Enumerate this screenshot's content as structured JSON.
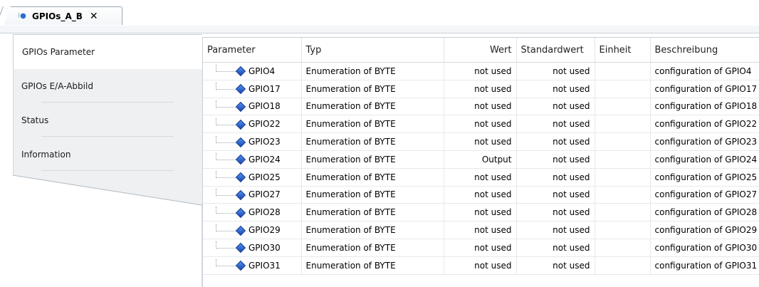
{
  "tab": {
    "title": "GPIOs_A_B",
    "close_symbol": "✕",
    "icon": "device-io-icon"
  },
  "nav": {
    "items": [
      {
        "label": "GPIOs Parameter",
        "active": true
      },
      {
        "label": "GPIOs E/A-Abbild",
        "active": false
      },
      {
        "label": "Status",
        "active": false
      },
      {
        "label": "Information",
        "active": false
      }
    ]
  },
  "table": {
    "columns": [
      "Parameter",
      "Typ",
      "Wert",
      "Standardwert",
      "Einheit",
      "Beschreibung"
    ],
    "rows": [
      {
        "param": "GPIO4",
        "typ": "Enumeration of BYTE",
        "wert": "not used",
        "standard": "not used",
        "einheit": "",
        "beschreibung": "configuration of GPIO4"
      },
      {
        "param": "GPIO17",
        "typ": "Enumeration of BYTE",
        "wert": "not used",
        "standard": "not used",
        "einheit": "",
        "beschreibung": "configuration of GPIO17"
      },
      {
        "param": "GPIO18",
        "typ": "Enumeration of BYTE",
        "wert": "not used",
        "standard": "not used",
        "einheit": "",
        "beschreibung": "configuration of GPIO18"
      },
      {
        "param": "GPIO22",
        "typ": "Enumeration of BYTE",
        "wert": "not used",
        "standard": "not used",
        "einheit": "",
        "beschreibung": "configuration of GPIO22"
      },
      {
        "param": "GPIO23",
        "typ": "Enumeration of BYTE",
        "wert": "not used",
        "standard": "not used",
        "einheit": "",
        "beschreibung": "configuration of GPIO23"
      },
      {
        "param": "GPIO24",
        "typ": "Enumeration of BYTE",
        "wert": "Output",
        "standard": "not used",
        "einheit": "",
        "beschreibung": "configuration of GPIO24"
      },
      {
        "param": "GPIO25",
        "typ": "Enumeration of BYTE",
        "wert": "not used",
        "standard": "not used",
        "einheit": "",
        "beschreibung": "configuration of GPIO25"
      },
      {
        "param": "GPIO27",
        "typ": "Enumeration of BYTE",
        "wert": "not used",
        "standard": "not used",
        "einheit": "",
        "beschreibung": "configuration of GPIO27"
      },
      {
        "param": "GPIO28",
        "typ": "Enumeration of BYTE",
        "wert": "not used",
        "standard": "not used",
        "einheit": "",
        "beschreibung": "configuration of GPIO28"
      },
      {
        "param": "GPIO29",
        "typ": "Enumeration of BYTE",
        "wert": "not used",
        "standard": "not used",
        "einheit": "",
        "beschreibung": "configuration of GPIO29"
      },
      {
        "param": "GPIO30",
        "typ": "Enumeration of BYTE",
        "wert": "not used",
        "standard": "not used",
        "einheit": "",
        "beschreibung": "configuration of GPIO30"
      },
      {
        "param": "GPIO31",
        "typ": "Enumeration of BYTE",
        "wert": "not used",
        "standard": "not used",
        "einheit": "",
        "beschreibung": "configuration of GPIO31"
      }
    ]
  }
}
